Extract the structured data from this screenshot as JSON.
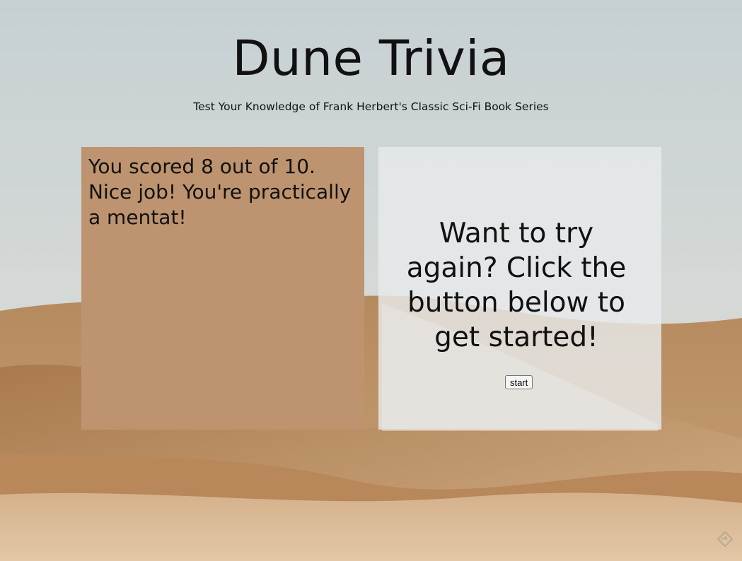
{
  "header": {
    "title": "Dune Trivia",
    "subtitle": "Test Your Knowledge of Frank Herbert's Classic Sci-Fi Book Series"
  },
  "results": {
    "score_message": "You scored 8 out of 10. Nice job! You're practically a mentat!"
  },
  "retry": {
    "prompt": "Want to try again? Click the button below to get started!",
    "start_label": "start"
  },
  "background": {
    "description_icon": "desert-dunes-background",
    "sky_color": "#cdd5d6",
    "sand_color": "#c39a6c"
  },
  "corner": {
    "icon": "diamond-arrow-icon"
  }
}
